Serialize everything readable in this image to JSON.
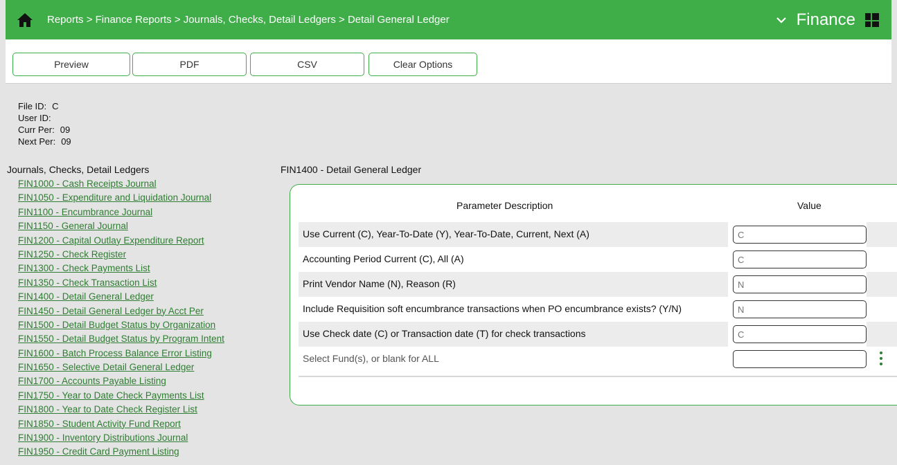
{
  "header": {
    "breadcrumb": "Reports > Finance Reports > Journals, Checks, Detail Ledgers > Detail General Ledger",
    "app_name": "Finance",
    "home_icon": "home-icon",
    "dropdown_icon": "chevron-down-icon",
    "apps_icon": "grid-icon",
    "bg_color": "#3fae49"
  },
  "toolbar": {
    "preview_label": "Preview",
    "pdf_label": "PDF",
    "csv_label": "CSV",
    "clear_label": "Clear Options"
  },
  "file_info": {
    "file_id_label": "File ID:",
    "file_id_value": "C",
    "user_id_label": "User ID:",
    "user_id_value": "",
    "curr_per_label": "Curr Per:",
    "curr_per_value": "09",
    "next_per_label": "Next Per:",
    "next_per_value": "09"
  },
  "reports": {
    "title": "Journals, Checks, Detail Ledgers",
    "items": [
      "FIN1000 - Cash Receipts Journal",
      "FIN1050 - Expenditure and Liquidation Journal",
      "FIN1100 - Encumbrance Journal",
      "FIN1150 - General Journal",
      "FIN1200 - Capital Outlay Expenditure Report",
      "FIN1250 - Check Register",
      "FIN1300 - Check Payments List",
      "FIN1350 - Check Transaction List",
      "FIN1400 - Detail General Ledger",
      "FIN1450 - Detail General Ledger by Acct Per",
      "FIN1500 - Detail Budget Status by Organization",
      "FIN1550 - Detail Budget Status by Program Intent",
      "FIN1600 - Batch Process Balance Error Listing",
      "FIN1650 - Selective Detail General Ledger",
      "FIN1700 - Accounts Payable Listing",
      "FIN1750 - Year to Date Check Payments List",
      "FIN1800 - Year to Date Check Register List",
      "FIN1850 - Student Activity Fund Report",
      "FIN1900 - Inventory Distributions Journal",
      "FIN1950 - Credit Card Payment Listing"
    ]
  },
  "params": {
    "section_title": "FIN1400 - Detail General Ledger",
    "col_description": "Parameter Description",
    "col_value": "Value",
    "rows": [
      {
        "description": "Use Current (C), Year-To-Date (Y), Year-To-Date, Current, Next (A)",
        "placeholder": "C"
      },
      {
        "description": "Accounting Period Current (C), All (A)",
        "placeholder": "C"
      },
      {
        "description": "Print Vendor Name (N), Reason (R)",
        "placeholder": "N"
      },
      {
        "description": "Include Requisition soft encumbrance transactions when PO encumbrance exists? (Y/N)",
        "placeholder": "N"
      },
      {
        "description": "Use Check date (C) or Transaction date (T) for check transactions",
        "placeholder": "C"
      },
      {
        "description": "Select Fund(s), or blank for ALL",
        "placeholder": ""
      }
    ],
    "more_icon": "kebab-vertical-icon"
  }
}
